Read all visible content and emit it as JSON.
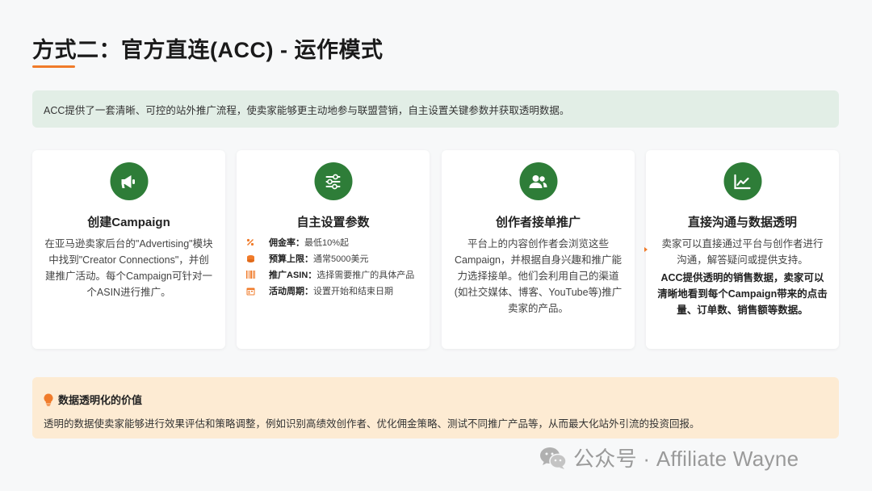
{
  "title": "方式二：官方直连(ACC) - 运作模式",
  "intro": "ACC提供了一套清晰、可控的站外推广流程，使卖家能够更主动地参与联盟营销，自主设置关键参数并获取透明数据。",
  "colors": {
    "accent_green": "#2e7d38",
    "accent_orange": "#f07b2a",
    "intro_bg": "#e2eee6",
    "value_bg": "#fdebd3"
  },
  "cards": [
    {
      "icon": "megaphone-icon",
      "title": "创建Campaign",
      "body": "在亚马逊卖家后台的\"Advertising\"模块中找到\"Creator Connections\"，并创建推广活动。每个Campaign可针对一个ASIN进行推广。"
    },
    {
      "icon": "sliders-icon",
      "title": "自主设置参数",
      "params": [
        {
          "icon": "percent-icon",
          "key": "佣金率：",
          "value": "最低10%起"
        },
        {
          "icon": "coins-icon",
          "key": "预算上限：",
          "value": "通常5000美元"
        },
        {
          "icon": "barcode-icon",
          "key": "推广ASIN：",
          "value": "选择需要推广的具体产品"
        },
        {
          "icon": "calendar-icon",
          "key": "活动周期：",
          "value": "设置开始和结束日期"
        }
      ]
    },
    {
      "icon": "users-icon",
      "title": "创作者接单推广",
      "body": "平台上的内容创作者会浏览这些Campaign，并根据自身兴趣和推广能力选择接单。他们会利用自己的渠道(如社交媒体、博客、YouTube等)推广卖家的产品。"
    },
    {
      "icon": "chart-line-icon",
      "title": "直接沟通与数据透明",
      "body": "卖家可以直接通过平台与创作者进行沟通，解答疑问或提供支持。",
      "body_bold": "ACC提供透明的销售数据，卖家可以清晰地看到每个Campaign带来的点击量、订单数、销售额等数据。"
    }
  ],
  "value": {
    "icon": "lightbulb-icon",
    "title": "数据透明化的价值",
    "body": "透明的数据使卖家能够进行效果评估和策略调整，例如识别高绩效创作者、优化佣金策略、测试不同推广产品等，从而最大化站外引流的投资回报。"
  },
  "watermark": {
    "icon": "wechat-icon",
    "text": "公众号 · Affiliate Wayne"
  }
}
